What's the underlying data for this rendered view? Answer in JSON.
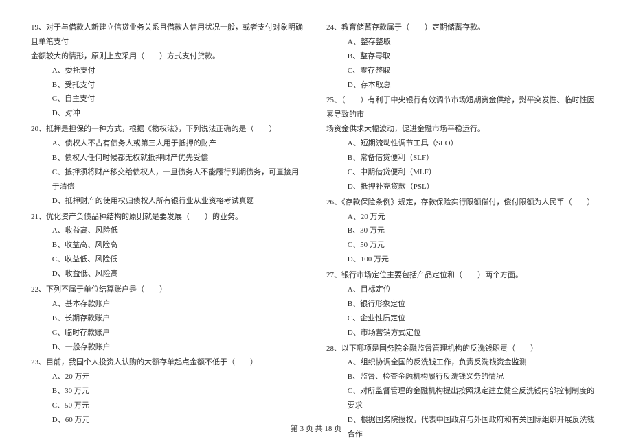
{
  "left": {
    "q19": {
      "stem1": "19、对于与借款人新建立信贷业务关系且借款人信用状况一般，或者支付对象明确且单笔支付",
      "stem2": "金额较大的情形，原则上应采用（　　）方式支付贷款。",
      "a": "A、委托支付",
      "b": "B、受托支付",
      "c": "C、自主支付",
      "d": "D、对冲"
    },
    "q20": {
      "stem": "20、抵押是担保的一种方式，根据《物权法》，下列说法正确的是（　　）",
      "a": "A、债权人不占有债务人或第三人用于抵押的财产",
      "b": "B、债权人任何时候都无权就抵押财产优先受偿",
      "c": "C、抵押须将财产移交给债权人，一旦债务人不能履行到期债务，可直接用于清偿",
      "d": "D、抵押财产的使用权归债权人所有银行业从业资格考试真题"
    },
    "q21": {
      "stem": "21、优化资产负债品种结构的原则就是要发展（　　）的业务。",
      "a": "A、收益高、风险低",
      "b": "B、收益高、风险高",
      "c": "C、收益低、风险低",
      "d": "D、收益低、风险高"
    },
    "q22": {
      "stem": "22、下列不属于单位结算账户是（　　）",
      "a": "A、基本存款账户",
      "b": "B、长期存款账户",
      "c": "C、临时存款账户",
      "d": "D、一般存款账户"
    },
    "q23": {
      "stem": "23、目前，我国个人投资人认购的大额存单起点金额不低于（　　）",
      "a": "A、20 万元",
      "b": "B、30 万元",
      "c": "C、50 万元",
      "d": "D、60 万元"
    }
  },
  "right": {
    "q24": {
      "stem": "24、教育储蓄存款属于（　　）定期储蓄存款。",
      "a": "A、整存整取",
      "b": "B、整存零取",
      "c": "C、零存整取",
      "d": "D、存本取息"
    },
    "q25": {
      "stem1": "25、（　　）有利于中央银行有效调节市场短期资金供给，熨平突发性、临时性因素导致的市",
      "stem2": "场资金供求大幅波动，促进金融市场平稳运行。",
      "a": "A、短期流动性调节工具（SLO）",
      "b": "B、常备借贷便利（SLF）",
      "c": "C、中期借贷便利（MLF）",
      "d": "D、抵押补充贷款（PSL）"
    },
    "q26": {
      "stem": "26、《存款保险条例》规定，存款保险实行限额偿付，偿付限额为人民币（　　）",
      "a": "A、20 万元",
      "b": "B、30 万元",
      "c": "C、50 万元",
      "d": "D、100 万元"
    },
    "q27": {
      "stem": "27、银行市场定位主要包括产品定位和（　　）两个方面。",
      "a": "A、目标定位",
      "b": "B、银行形象定位",
      "c": "C、企业性质定位",
      "d": "D、市场营销方式定位"
    },
    "q28": {
      "stem": "28、以下哪项是国务院金融监督管理机构的反洗钱职责（　　）",
      "a": "A、组织协调全国的反洗钱工作，负责反洗钱资金监测",
      "b": "B、监督、检查金融机构履行反洗钱义务的情况",
      "c": "C、对所监督管理的金融机构提出按照规定建立健全反洗钱内部控制制度的要求",
      "d": "D、根据国务院授权，代表中国政府与外国政府和有关国际组织开展反洗钱合作"
    }
  },
  "footer": "第 3 页  共 18 页"
}
